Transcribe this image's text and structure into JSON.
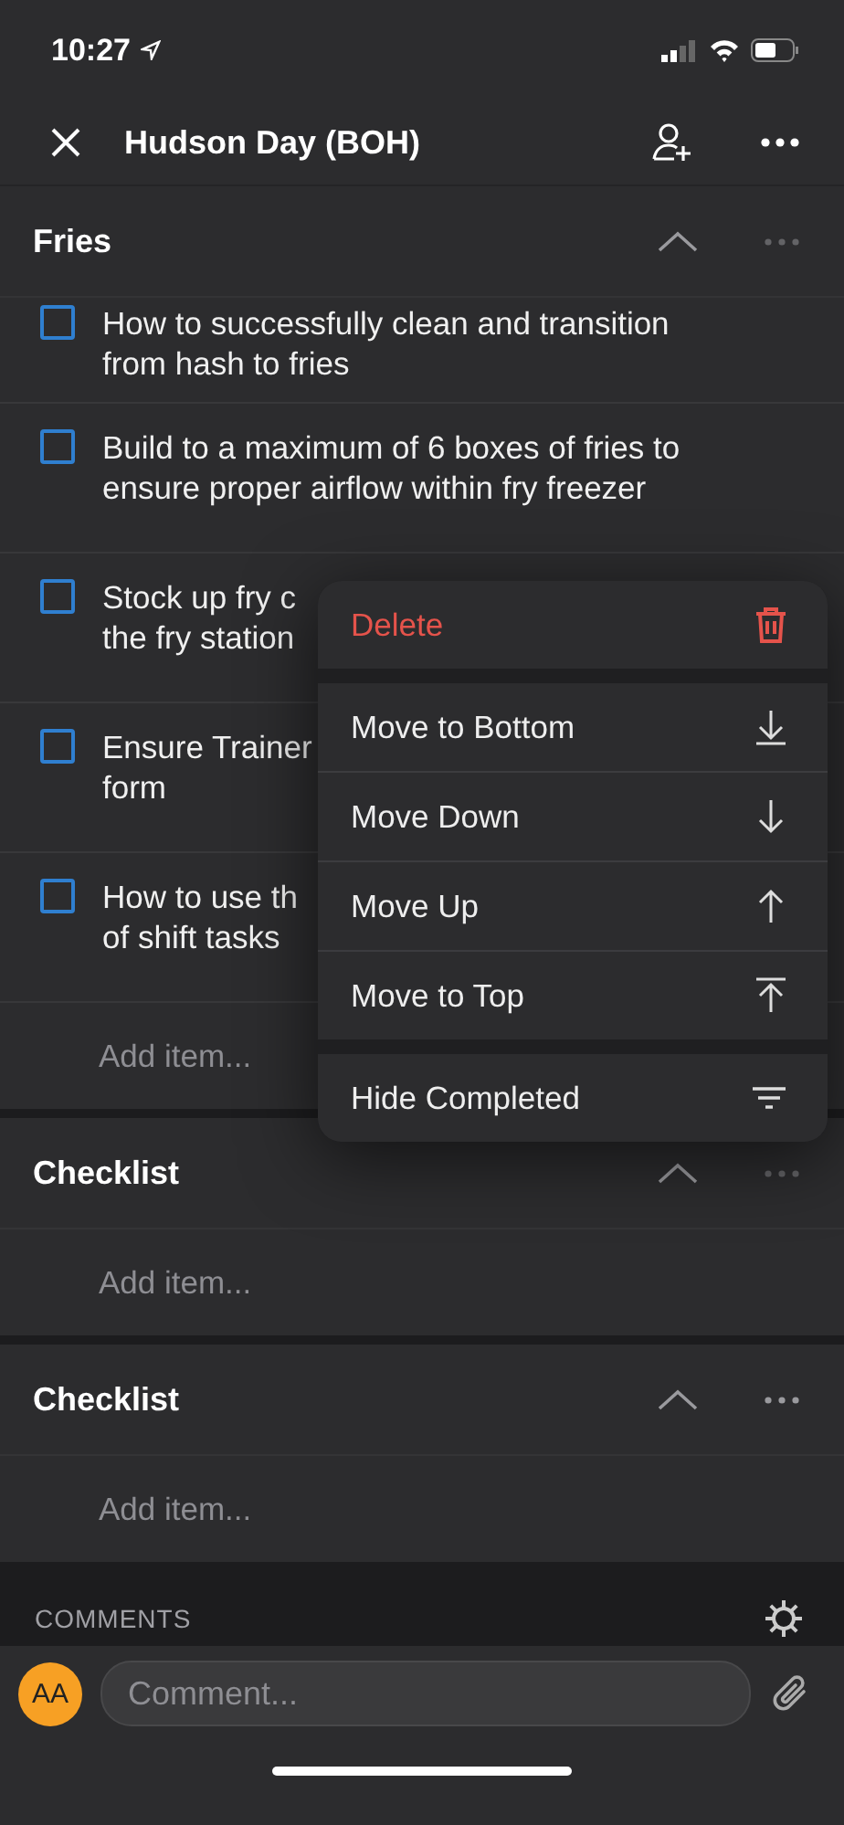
{
  "status_bar": {
    "time": "10:27"
  },
  "nav": {
    "title": "Hudson Day (BOH)"
  },
  "sections": [
    {
      "title": "Fries",
      "items": [
        {
          "lines": [
            "How to successfully clean and transition",
            "from hash to fries"
          ],
          "checked": false
        },
        {
          "lines": [
            "Build to a maximum of 6 boxes of fries to",
            "ensure proper airflow within fry freezer"
          ],
          "checked": false
        },
        {
          "lines": [
            "Stock up fry c",
            "the fry station"
          ],
          "checked": false
        },
        {
          "lines": [
            "Ensure Trainer",
            "form"
          ],
          "checked": false
        },
        {
          "lines": [
            "How to use th",
            "of shift tasks"
          ],
          "checked": false
        }
      ],
      "add_placeholder": "Add item..."
    },
    {
      "title": "Checklist",
      "add_placeholder": "Add item..."
    },
    {
      "title": "Checklist",
      "add_placeholder": "Add item..."
    }
  ],
  "menu": {
    "groups": [
      [
        {
          "label": "Delete",
          "kind": "delete",
          "destructive": true
        }
      ],
      [
        {
          "label": "Move to Bottom",
          "kind": "bottom",
          "destructive": false
        },
        {
          "label": "Move Down",
          "kind": "down",
          "destructive": false
        },
        {
          "label": "Move Up",
          "kind": "up",
          "destructive": false
        },
        {
          "label": "Move to Top",
          "kind": "top",
          "destructive": false
        }
      ],
      [
        {
          "label": "Hide Completed",
          "kind": "filter",
          "destructive": false
        }
      ]
    ]
  },
  "comments": {
    "heading": "COMMENTS",
    "avatar": "AA",
    "placeholder": "Comment..."
  }
}
